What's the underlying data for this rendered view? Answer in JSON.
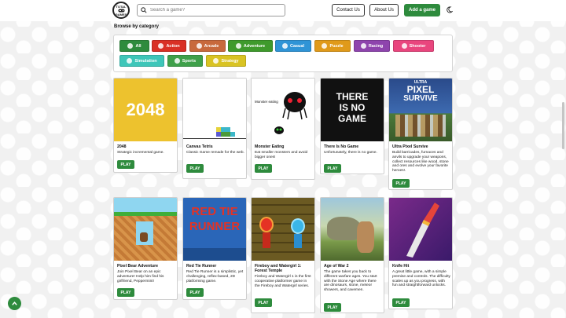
{
  "header": {
    "logo_line1": "TOTAL",
    "logo_line2": "GAMES",
    "search_placeholder": "Search a game?",
    "contact_label": "Contact Us",
    "about_label": "About Us",
    "add_label": "Add a game"
  },
  "browse": {
    "title": "Browse by category",
    "categories": [
      {
        "label": "All",
        "color": "#2e8b3d",
        "icon": "grid-icon"
      },
      {
        "label": "Action",
        "color": "#d93025",
        "icon": "fist-icon"
      },
      {
        "label": "Arcade",
        "color": "#c8693c",
        "icon": "joystick-icon"
      },
      {
        "label": "Adventure",
        "color": "#3f9a2c",
        "icon": "compass-icon"
      },
      {
        "label": "Casual",
        "color": "#2f94d6",
        "icon": "controller-icon"
      },
      {
        "label": "Puzzle",
        "color": "#e09a1a",
        "icon": "puzzle-icon"
      },
      {
        "label": "Racing",
        "color": "#8e44ad",
        "icon": "car-icon"
      },
      {
        "label": "Shooter",
        "color": "#e9467e",
        "icon": "target-icon"
      },
      {
        "label": "Simulation",
        "color": "#3ec6b9",
        "icon": "gear-icon"
      },
      {
        "label": "Sports",
        "color": "#3fa04a",
        "icon": "ball-icon"
      },
      {
        "label": "Strategy",
        "color": "#d9c323",
        "icon": "chess-icon"
      }
    ]
  },
  "games": [
    {
      "title": "2048",
      "desc": "Strategic incremental game.",
      "play": "PLAY",
      "thumb_text": "2048"
    },
    {
      "title": "Canvas Tetris",
      "desc": "Classic Game remade for the web.",
      "play": "PLAY"
    },
    {
      "title": "Monster Eating",
      "desc": "Eat smaller monsters and avoid bigger ones!",
      "play": "PLAY",
      "thumb_text": "Monster eating"
    },
    {
      "title": "There Is No Game",
      "desc": "Unfortunately, there is no game.",
      "play": "PLAY",
      "thumb_text": [
        "THERE",
        "IS NO",
        "GAME"
      ]
    },
    {
      "title": "Ultra Pixel Survive",
      "desc": "Build barricades, furnaces and anvils to upgrade your weapons, collect resources like wood, stone and ores and evolve your favorite heroes!.",
      "play": "PLAY",
      "thumb_text": [
        "ULTRA",
        "PIXEL",
        "SURVIVE"
      ]
    },
    {
      "title": "Pixel Bear Adventure",
      "desc": "Join Pixel Bear on an epic adventure! Help him find his girlfriend, Peppermint!",
      "play": "PLAY"
    },
    {
      "title": "Red Tie Runner",
      "desc": "Red Tie Runner is a simplistic, yet challenging, reflex-based, 2D platforming game.",
      "play": "PLAY",
      "thumb_text": [
        "RED TIE",
        "RUNNER"
      ]
    },
    {
      "title": "Fireboy and Watergirl 1: Forest Temple",
      "desc": "Fireboy and Watergirl 1 is the first cooperative platformer game in the Fireboy and Watergirl series.",
      "play": "PLAY"
    },
    {
      "title": "Age of War 2",
      "desc": "The game takes you back to different warfare ages. You start with the Stone Age where there are dinosaurs, stone, meteor showers, and cavemen.",
      "play": "PLAY"
    },
    {
      "title": "Knife Hit",
      "desc": "A great little game, with a simple premise and controls. The difficulty scales up as you progress, with fun and straightforward unlocks.",
      "play": "PLAY"
    }
  ]
}
